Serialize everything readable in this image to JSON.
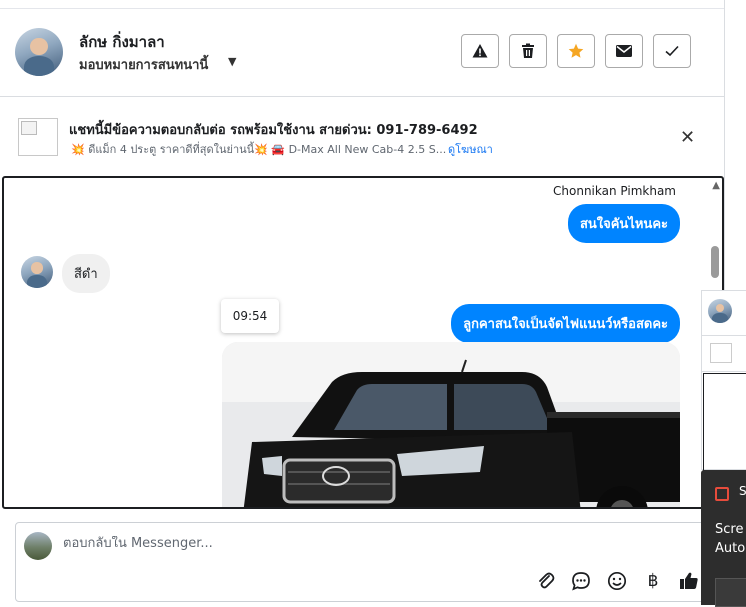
{
  "header": {
    "name": "ลักษ กิ่งมาลา",
    "assign_label": "มอบหมายการสนทนานี้",
    "actions": [
      "warning-icon",
      "trash-icon",
      "star-icon",
      "envelope-icon",
      "check-icon"
    ],
    "star_color": "#f5a623"
  },
  "ad": {
    "title": "แชทนี้มีข้อความตอบกลับต่อ รถพร้อมใช้งาน สายด่วน: 091-789-6492",
    "subtitle": "💥 ดีแม็ก 4 ประตู ราคาดีที่สุดในย่านนี้💥 🚘 D-Max All New Cab-4 2.5 S...",
    "link": "ดูโฆษณา"
  },
  "conversation": {
    "sender_name": "Chonnikan Pimkham",
    "messages": {
      "out1": "สนใจคันไหนคะ",
      "in1": "สีดำ",
      "out2": "ลูกคาสนใจเป็นจัดไฟแนนว์หรือสดคะ"
    },
    "timestamp": "09:54",
    "accent": "#0084ff"
  },
  "composer": {
    "placeholder": "ตอบกลับใน Messenger...",
    "icons": [
      "paperclip-icon",
      "message-bubble-icon",
      "emoji-icon",
      "baht-icon",
      "thumbs-up-icon"
    ]
  },
  "overlay": {
    "line1": "Scre",
    "line2": "Auto",
    "snip_label": "S"
  }
}
